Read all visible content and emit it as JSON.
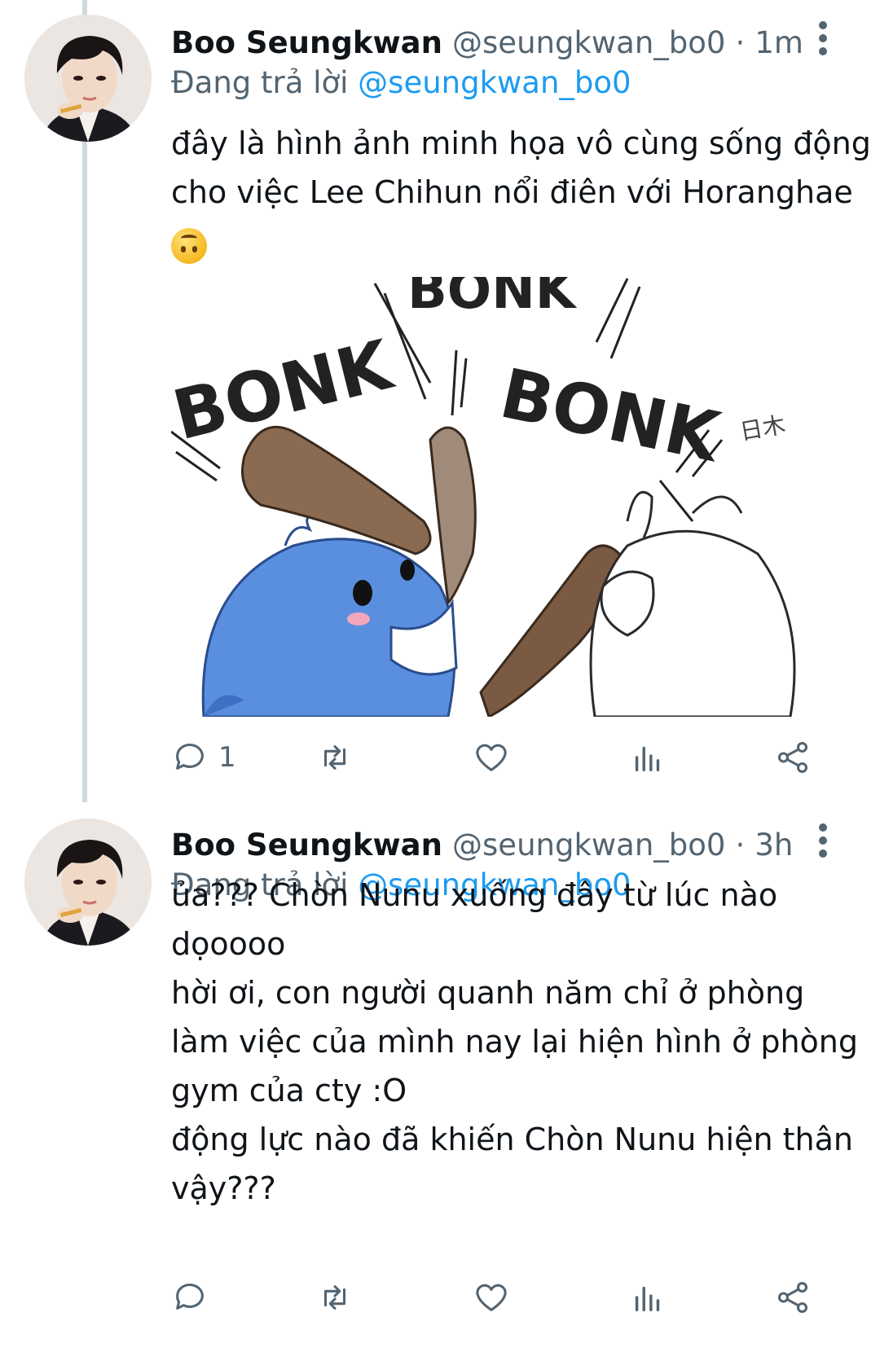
{
  "thread": {
    "tweets": [
      {
        "display_name": "Boo Seungkwan",
        "handle": "@seungkwan_bo0",
        "separator": "·",
        "time": "1m",
        "reply_prefix": "Đang trả lời",
        "reply_handle": "@seungkwan_bo0",
        "text_lines": [
          "đây là hình ảnh minh họa vô cùng sống động",
          "cho việc Lee Chihun nổi điên với Horanghae"
        ],
        "emoji": "upside-down-face",
        "media": {
          "sfx_1": "BONK",
          "sfx_2": "BONK",
          "sfx_top": "BONK",
          "signature": "日木"
        },
        "reply_count": "1"
      },
      {
        "display_name": "Boo Seungkwan",
        "handle": "@seungkwan_bo0",
        "separator": "·",
        "time": "3h",
        "reply_prefix": "Đang trả lời",
        "reply_handle": "@seungkwan_bo0",
        "text_lines": [
          "ủa??? Chòn Nunu xuống đây từ lúc nào",
          "dọoooo",
          "hời ơi, con người quanh năm chỉ ở phòng",
          "làm việc của mình nay lại hiện hình ở phòng",
          "gym của cty :O",
          "động lực nào đã khiến Chòn Nunu hiện thân",
          "vậy???"
        ],
        "reply_count": ""
      }
    ]
  },
  "icons": [
    "reply-icon",
    "retweet-icon",
    "like-icon",
    "stats-icon",
    "share-icon",
    "more-icon"
  ],
  "colors": {
    "text": "#0f1419",
    "secondary": "#536471",
    "link": "#1d9bf0",
    "thread_line": "#cfd9de"
  }
}
